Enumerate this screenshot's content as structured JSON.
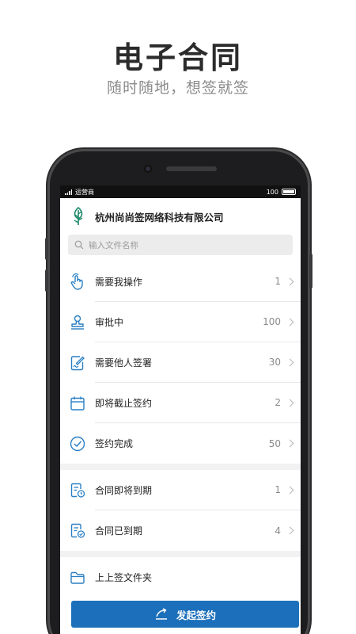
{
  "promo": {
    "title": "电子合同",
    "subtitle": "随时随地，想签就签"
  },
  "status_bar": {
    "carrier": "运营商",
    "battery": "100"
  },
  "company": {
    "name": "杭州尚尚签网络科技有限公司",
    "logo_icon": "leaf-logo"
  },
  "search": {
    "placeholder": "输入文件名称"
  },
  "colors": {
    "accent": "#1c6fba",
    "icon": "#2a7fc4"
  },
  "section1": [
    {
      "label": "需要我操作",
      "count": "1",
      "icon": "hand-pointer-icon"
    },
    {
      "label": "审批中",
      "count": "100",
      "icon": "stamp-icon"
    },
    {
      "label": "需要他人签署",
      "count": "30",
      "icon": "sign-document-icon"
    },
    {
      "label": "即将截止签约",
      "count": "2",
      "icon": "calendar-icon"
    },
    {
      "label": "签约完成",
      "count": "50",
      "icon": "check-circle-icon"
    }
  ],
  "section2": [
    {
      "label": "合同即将到期",
      "count": "1",
      "icon": "contract-clock-icon"
    },
    {
      "label": "合同已到期",
      "count": "4",
      "icon": "contract-check-icon"
    }
  ],
  "section3": [
    {
      "label": "上上签文件夹",
      "icon": "folder-icon"
    }
  ],
  "action_button": {
    "label": "发起签约",
    "icon": "send-arrow-icon"
  }
}
